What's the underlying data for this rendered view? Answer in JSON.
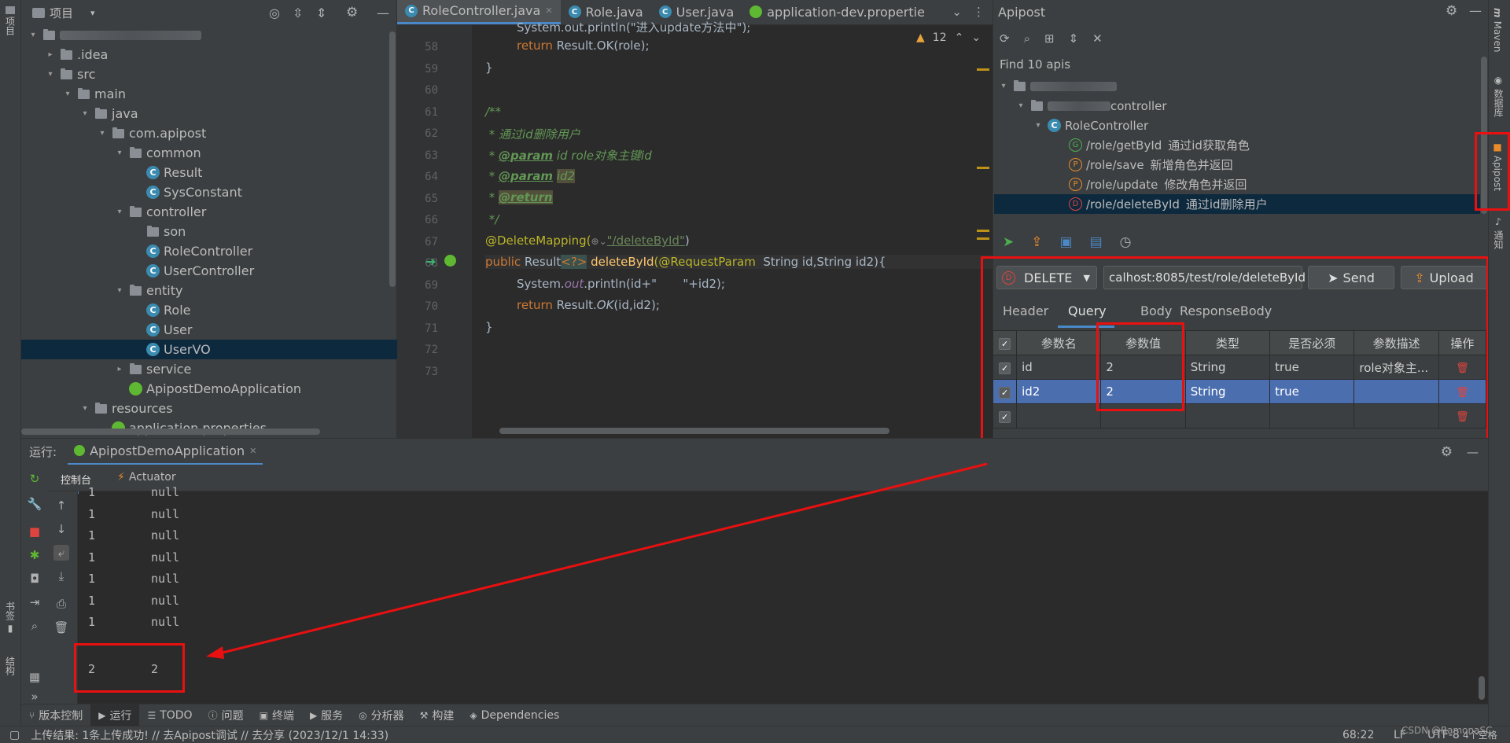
{
  "left_strip": {
    "project_label": "项目",
    "bookmarks_label": "书签",
    "structure_label": "结构"
  },
  "project": {
    "title": "项目",
    "tree": [
      {
        "label": "",
        "arrow": "▾",
        "icon": "folder",
        "blurred": true
      },
      {
        "label": ".idea",
        "arrow": "▸",
        "icon": "folder"
      },
      {
        "label": "src",
        "arrow": "▾",
        "icon": "folder"
      },
      {
        "label": "main",
        "arrow": "▾",
        "icon": "folder"
      },
      {
        "label": "java",
        "arrow": "▾",
        "icon": "folder"
      },
      {
        "label": "com.apipost",
        "arrow": "▾",
        "icon": "folder"
      },
      {
        "label": "common",
        "arrow": "▾",
        "icon": "folder"
      },
      {
        "label": "Result",
        "arrow": "",
        "icon": "class"
      },
      {
        "label": "SysConstant",
        "arrow": "",
        "icon": "class"
      },
      {
        "label": "controller",
        "arrow": "▾",
        "icon": "folder"
      },
      {
        "label": "son",
        "arrow": "",
        "icon": "folder"
      },
      {
        "label": "RoleController",
        "arrow": "",
        "icon": "class"
      },
      {
        "label": "UserController",
        "arrow": "",
        "icon": "class"
      },
      {
        "label": "entity",
        "arrow": "▾",
        "icon": "folder"
      },
      {
        "label": "Role",
        "arrow": "",
        "icon": "class"
      },
      {
        "label": "User",
        "arrow": "",
        "icon": "class"
      },
      {
        "label": "UserVO",
        "arrow": "",
        "icon": "class",
        "selected": true
      },
      {
        "label": "service",
        "arrow": "▸",
        "icon": "folder"
      },
      {
        "label": "ApipostDemoApplication",
        "arrow": "",
        "icon": "spring"
      },
      {
        "label": "resources",
        "arrow": "▾",
        "icon": "folder"
      },
      {
        "label": "application.properties",
        "arrow": "",
        "icon": "spring"
      }
    ]
  },
  "editor": {
    "tabs": [
      {
        "label": "RoleController.java",
        "active": true
      },
      {
        "label": "Role.java",
        "active": false
      },
      {
        "label": "User.java",
        "active": false
      },
      {
        "label": "application-dev.propertie",
        "active": false
      }
    ],
    "warning_count": "12",
    "line_numbers": [
      "58",
      "59",
      "60",
      "61",
      "62",
      "63",
      "64",
      "65",
      "66",
      "67",
      "68",
      "69",
      "70",
      "71",
      "72",
      "73"
    ],
    "code": {
      "l57": "System.out.println(\"进入update方法中\");",
      "l58_kw": "return",
      "l58_rest": " Result.OK(role);",
      "l59": "}",
      "l61": "/**",
      "l62": " * 通过id删除用户",
      "l63_a": " * ",
      "l63_tag": "@param",
      "l63_b": " id role对象主键id",
      "l64_a": " * ",
      "l64_tag": "@param",
      "l64_b": "id2",
      "l65_a": " * ",
      "l65_tag": "@return",
      "l66": " */",
      "l67_an": "@DeleteMapping(",
      "l67_st": "\"/deleteById\"",
      "l67_end": ")",
      "l68_kw": "public",
      "l68_type": " Result",
      "l68_gen": "<?>",
      "l68_fn": " deleteById",
      "l68_an": "(@RequestParam",
      "l68_rest": "  String id,String id2){",
      "l69_a": "System.",
      "l69_out": "out",
      "l69_b": ".println(id+\"       \"+id2);",
      "l70_kw": "return",
      "l70_a": " Result.",
      "l70_ok": "OK",
      "l70_b": "(id,id2);",
      "l71": "}"
    }
  },
  "apipost": {
    "title": "Apipost",
    "find_label": "Find 10 apis",
    "controller_label": "controller",
    "role_controller": "RoleController",
    "apis": [
      {
        "method": "G",
        "type": "get",
        "path": "/role/getById",
        "desc": "通过id获取角色",
        "selected": false
      },
      {
        "method": "P",
        "type": "post",
        "path": "/role/save",
        "desc": "新增角色并返回",
        "selected": false
      },
      {
        "method": "P",
        "type": "post",
        "path": "/role/update",
        "desc": "修改角色并返回",
        "selected": false
      },
      {
        "method": "D",
        "type": "delete",
        "path": "/role/deleteById",
        "desc": "通过id删除用户",
        "selected": true
      }
    ],
    "method_select": "DELETE",
    "url": "calhost:8085/test/role/deleteById",
    "send_label": "Send",
    "upload_label": "Upload",
    "subtabs": [
      "Header",
      "Query",
      "Body",
      "ResponseBody"
    ],
    "active_subtab": "Query",
    "table_headers": [
      "参数名",
      "参数值",
      "类型",
      "是否必须",
      "参数描述",
      "操作"
    ],
    "rows": [
      {
        "name": "id",
        "value": "2",
        "type": "String",
        "required": "true",
        "desc": "role对象主..."
      },
      {
        "name": "id2",
        "value": "2",
        "type": "String",
        "required": "true",
        "desc": ""
      },
      {
        "name": "",
        "value": "",
        "type": "",
        "required": "",
        "desc": ""
      }
    ]
  },
  "right_strip": {
    "maven": "Maven",
    "database": "数据库",
    "apipost": "Apipost",
    "notify": "通知"
  },
  "run": {
    "label": "运行:",
    "config": "ApipostDemoApplication",
    "console_tab": "控制台",
    "actuator_tab": "Actuator",
    "lines": [
      {
        "a": "1",
        "b": "null"
      },
      {
        "a": "1",
        "b": "null"
      },
      {
        "a": "1",
        "b": "null"
      },
      {
        "a": "1",
        "b": "null"
      },
      {
        "a": "1",
        "b": "null"
      },
      {
        "a": "1",
        "b": "null"
      },
      {
        "a": "1",
        "b": "null"
      }
    ],
    "result": {
      "a": "2",
      "b": "2"
    }
  },
  "bottom_tabs": [
    "版本控制",
    "运行",
    "TODO",
    "问题",
    "终端",
    "服务",
    "分析器",
    "构建",
    "Dependencies"
  ],
  "status": {
    "message": "上传结果: 1条上传成功!  // 去Apipost调试 // 去分享 (2023/12/1 14:33)",
    "position": "68:22",
    "line_sep": "LF",
    "encoding": "UTF-8",
    "indent": "4个空格",
    "watermark": "CSDN @RamonaSC"
  }
}
